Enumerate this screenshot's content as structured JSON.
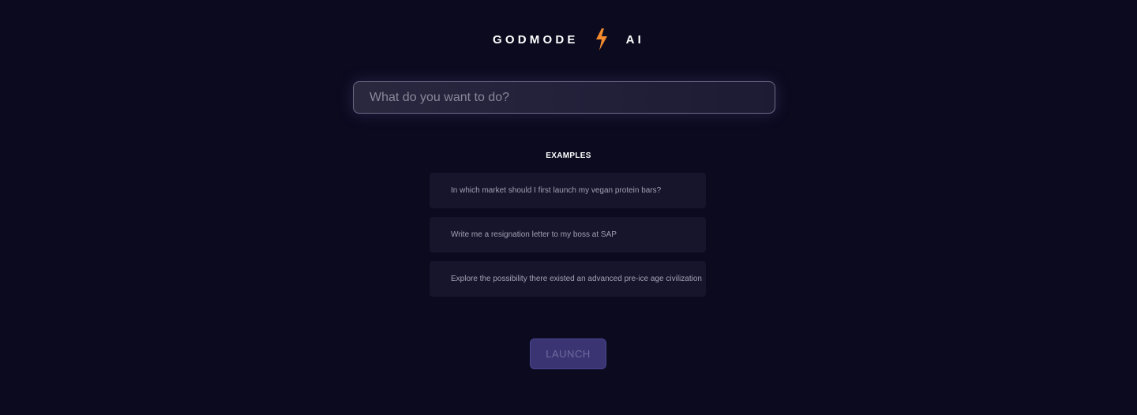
{
  "logo": {
    "left_text": "GODMODE",
    "icon": "lightning-bolt-icon",
    "right_text": "AI",
    "icon_color": "#f28a2e"
  },
  "search": {
    "placeholder": "What do you want to do?",
    "value": ""
  },
  "examples": {
    "heading": "EXAMPLES",
    "items": [
      {
        "label": "In which market should I first launch my vegan protein bars?"
      },
      {
        "label": "Write me a resignation letter to my boss at SAP"
      },
      {
        "label": "Explore the possibility there existed an advanced pre-ice age civilization"
      }
    ]
  },
  "launch": {
    "label": "LAUNCH"
  },
  "colors": {
    "background": "#0b0a1f",
    "card": "#16152b",
    "button": "#3a3572",
    "accent": "#f28a2e"
  }
}
